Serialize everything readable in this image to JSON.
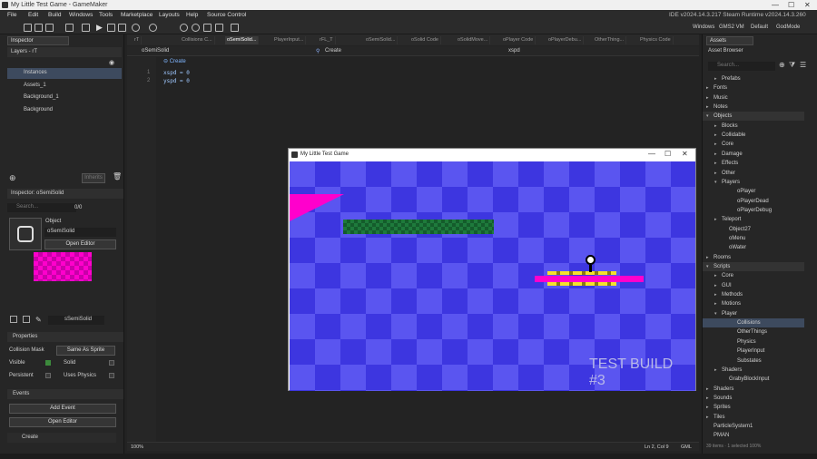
{
  "window": {
    "title": "My Little Test Game - GameMaker",
    "min": "—",
    "max": "☐",
    "close": "✕"
  },
  "menu": [
    "File",
    "Edit",
    "Build",
    "Windows",
    "Tools",
    "Marketplace",
    "Layouts",
    "Help",
    "Source Control"
  ],
  "ide_info": "IDE v2024.14.3.217 Steam  Runtime v2024.14.3.260",
  "target": {
    "platform": "Windows",
    "vm": "GMS2 VM",
    "config": "Default",
    "user": "GodMode"
  },
  "inspector": {
    "tab": "Inspector",
    "layers_label": "Layers - rT",
    "layers": [
      {
        "name": "Instances",
        "selected": true
      },
      {
        "name": "Assets_1"
      },
      {
        "name": "Background_1"
      },
      {
        "name": "Background"
      }
    ],
    "inherit_btn": "Inherits",
    "obj_header": "Inspector: oSemiSolid",
    "search_placeholder": "Search...",
    "search_count": "0/0",
    "object_label": "Object",
    "object_name": "oSemiSolid",
    "open_editor": "Open Editor",
    "sprite_name": "sSemiSolid",
    "properties_title": "Properties",
    "collision_mask_label": "Collision Mask",
    "collision_mask_value": "Same As Sprite",
    "visible_label": "Visible",
    "solid_label": "Solid",
    "persistent_label": "Persistent",
    "uses_physics_label": "Uses Physics",
    "events_title": "Events",
    "add_event": "Add Event",
    "open_editor2": "Open Editor",
    "event_create": "Create"
  },
  "editor": {
    "tabs": [
      "rT",
      "Collisions C...",
      "oSemiSolid...",
      "PlayerInput...",
      "rFL_T",
      "oSemiSolid...",
      "oSolid Code",
      "oSolidMove...",
      "oPlayer Code",
      "oPlayerDebu...",
      "OtherThing...",
      "Physics Code"
    ],
    "object": "oSemiSolid",
    "event": "Create",
    "search_text": "xspd",
    "region": "Create",
    "lines": [
      {
        "n": "1",
        "code": "xspd = 0"
      },
      {
        "n": "2",
        "code": "yspd = 0"
      }
    ],
    "zoom": "100%",
    "cursor": "Ln 2, Col 9",
    "lang": "GML"
  },
  "game": {
    "title": "My Little Test Game",
    "watermark1": "TEST BUILD",
    "watermark2": "#3"
  },
  "assets": {
    "tab": "Assets",
    "browser": "Asset Browser",
    "search_placeholder": "Search...",
    "items": [
      {
        "label": "Prefabs",
        "lvl": 1,
        "arrow": "▸"
      },
      {
        "label": "Fonts",
        "lvl": 0,
        "arrow": "▸"
      },
      {
        "label": "Music",
        "lvl": 0,
        "arrow": "▸"
      },
      {
        "label": "Notes",
        "lvl": 0,
        "arrow": "▸"
      },
      {
        "label": "Objects",
        "lvl": 0,
        "arrow": "▾",
        "hl": true
      },
      {
        "label": "Blocks",
        "lvl": 1,
        "arrow": "▸"
      },
      {
        "label": "Collidable",
        "lvl": 1,
        "arrow": "▸"
      },
      {
        "label": "Core",
        "lvl": 1,
        "arrow": "▸"
      },
      {
        "label": "Damage",
        "lvl": 1,
        "arrow": "▸"
      },
      {
        "label": "Effects",
        "lvl": 1,
        "arrow": "▸"
      },
      {
        "label": "Other",
        "lvl": 1,
        "arrow": "▸"
      },
      {
        "label": "Players",
        "lvl": 1,
        "arrow": "▾"
      },
      {
        "label": "oPlayer",
        "lvl": 2,
        "arrow": ""
      },
      {
        "label": "oPlayerDead",
        "lvl": 2,
        "arrow": ""
      },
      {
        "label": "oPlayerDebug",
        "lvl": 2,
        "arrow": ""
      },
      {
        "label": "Teleport",
        "lvl": 1,
        "arrow": "▸"
      },
      {
        "label": "Object27",
        "lvl": 1,
        "arrow": ""
      },
      {
        "label": "oMenu",
        "lvl": 1,
        "arrow": ""
      },
      {
        "label": "oWater",
        "lvl": 1,
        "arrow": ""
      },
      {
        "label": "Rooms",
        "lvl": 0,
        "arrow": "▸"
      },
      {
        "label": "Scripts",
        "lvl": 0,
        "arrow": "▾",
        "hl": true
      },
      {
        "label": "Core",
        "lvl": 1,
        "arrow": "▸"
      },
      {
        "label": "GUI",
        "lvl": 1,
        "arrow": "▸"
      },
      {
        "label": "Methods",
        "lvl": 1,
        "arrow": "▸"
      },
      {
        "label": "Motions",
        "lvl": 1,
        "arrow": "▸"
      },
      {
        "label": "Player",
        "lvl": 1,
        "arrow": "▾"
      },
      {
        "label": "Collisions",
        "lvl": 2,
        "arrow": "",
        "sel": true
      },
      {
        "label": "OtherThings",
        "lvl": 2,
        "arrow": ""
      },
      {
        "label": "Physics",
        "lvl": 2,
        "arrow": ""
      },
      {
        "label": "PlayerInput",
        "lvl": 2,
        "arrow": ""
      },
      {
        "label": "Substates",
        "lvl": 2,
        "arrow": ""
      },
      {
        "label": "Shaders",
        "lvl": 1,
        "arrow": "▸"
      },
      {
        "label": "GrabyBlockInput",
        "lvl": 1,
        "arrow": ""
      },
      {
        "label": "Shaders",
        "lvl": 0,
        "arrow": "▸"
      },
      {
        "label": "Sounds",
        "lvl": 0,
        "arrow": "▸"
      },
      {
        "label": "Sprites",
        "lvl": 0,
        "arrow": "▸"
      },
      {
        "label": "Tiles",
        "lvl": 0,
        "arrow": "▸"
      },
      {
        "label": "ParticleSystem1",
        "lvl": 0,
        "arrow": ""
      },
      {
        "label": "PMAN",
        "lvl": 0,
        "arrow": ""
      }
    ],
    "footer": "39 items · 1 selected  100%"
  },
  "colors": {
    "accent": "#4a90e2",
    "magenta": "#ff00cc",
    "green_block": "#1e7a3c",
    "yellow": "#f5e12c"
  }
}
